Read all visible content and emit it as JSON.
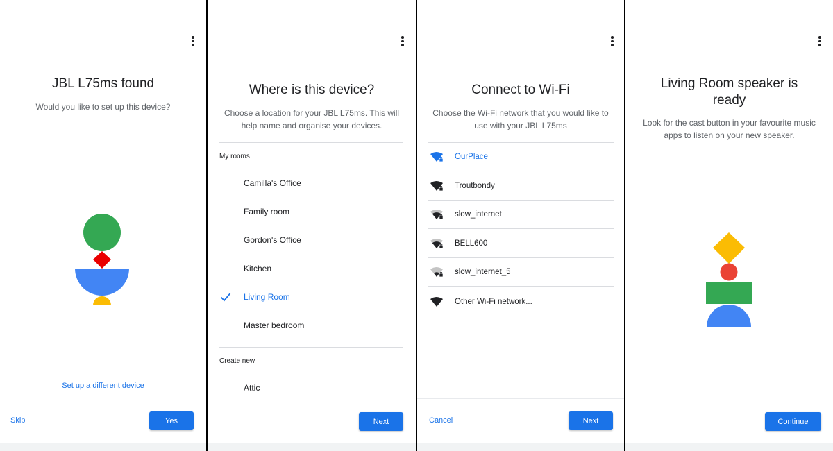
{
  "screen1": {
    "title": "JBL L75ms found",
    "subtitle": "Would you like to set up this device?",
    "alt_link": "Set up a different device",
    "skip_label": "Skip",
    "yes_label": "Yes"
  },
  "screen2": {
    "title": "Where is this device?",
    "subtitle": "Choose a location for your JBL L75ms. This will help name and organise your devices.",
    "my_rooms_label": "My rooms",
    "rooms": [
      {
        "label": "Camilla's Office",
        "selected": false
      },
      {
        "label": "Family room",
        "selected": false
      },
      {
        "label": "Gordon's Office",
        "selected": false
      },
      {
        "label": "Kitchen",
        "selected": false
      },
      {
        "label": "Living Room",
        "selected": true
      },
      {
        "label": "Master bedroom",
        "selected": false
      }
    ],
    "create_new_label": "Create new",
    "create_new_items": [
      "Attic"
    ],
    "next_label": "Next"
  },
  "screen3": {
    "title": "Connect to Wi-Fi",
    "subtitle": "Choose the Wi-Fi network that you would like to use with your JBL L75ms",
    "networks": [
      {
        "label": "OurPlace",
        "active": true,
        "secured": true,
        "strength": "full"
      },
      {
        "label": "Troutbondy",
        "active": false,
        "secured": true,
        "strength": "full"
      },
      {
        "label": "slow_internet",
        "active": false,
        "secured": true,
        "strength": "medium"
      },
      {
        "label": "BELL600",
        "active": false,
        "secured": true,
        "strength": "medium"
      },
      {
        "label": "slow_internet_5",
        "active": false,
        "secured": true,
        "strength": "weak"
      },
      {
        "label": "Other Wi-Fi network...",
        "active": false,
        "secured": false,
        "strength": "full"
      }
    ],
    "cancel_label": "Cancel",
    "next_label": "Next"
  },
  "screen4": {
    "title": "Living Room speaker is ready",
    "subtitle": "Look for the cast button in your favourite music apps to listen on your new speaker.",
    "continue_label": "Continue"
  },
  "colors": {
    "accent": "#1a73e8",
    "google_green": "#34a853",
    "google_red": "#ea4335",
    "google_blue": "#4285f4",
    "google_yellow": "#fbbc04"
  }
}
